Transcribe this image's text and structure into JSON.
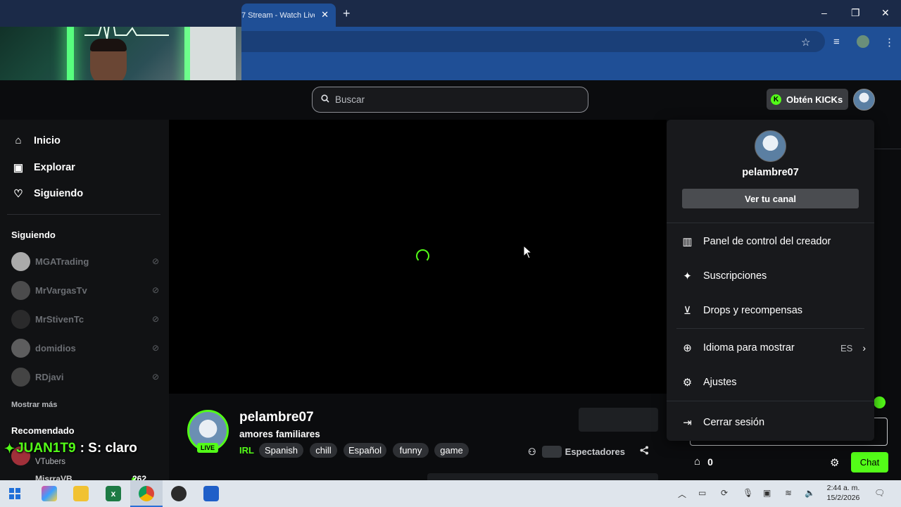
{
  "browser": {
    "tab_title": "7 Stream - Watch Live",
    "tab_close": "✕",
    "new_tab": "+",
    "window_controls": {
      "minimize": "–",
      "restore": "❐",
      "close": "✕"
    }
  },
  "header": {
    "search_placeholder": "Buscar",
    "kicks_button": "Obtén KICKs",
    "kicks_badge": "K"
  },
  "sidebar": {
    "nav": [
      {
        "label": "Inicio",
        "icon": "home-icon"
      },
      {
        "label": "Explorar",
        "icon": "browse-icon"
      },
      {
        "label": "Siguiendo",
        "icon": "heart-icon"
      }
    ],
    "following_title": "Siguiendo",
    "following": [
      {
        "name": "MGATrading"
      },
      {
        "name": "MrVargasTv"
      },
      {
        "name": "MrStivenTc"
      },
      {
        "name": "domidios"
      },
      {
        "name": "RDjavi"
      }
    ],
    "show_more": "Mostrar más",
    "recommended_title": "Recomendado",
    "recommended": [
      {
        "category": "VTubers"
      },
      {
        "name": "MisrraVB",
        "viewers": "262"
      }
    ]
  },
  "chat_overlay": {
    "user": "JUAN1T9",
    "message": ": S: claro"
  },
  "stream": {
    "streamer": "pelambre07",
    "title": "amores familiares",
    "live_badge": "LIVE",
    "category": "IRL",
    "tags": [
      "Spanish",
      "chill",
      "Español",
      "funny",
      "game"
    ],
    "viewers_label": "Espectadores"
  },
  "chat": {
    "gift_count": "0",
    "chat_button": "Chat"
  },
  "menu": {
    "username": "pelambre07",
    "view_channel": "Ver tu canal",
    "items": [
      {
        "label": "Panel de control del creador",
        "icon": "dashboard-icon"
      },
      {
        "label": "Suscripciones",
        "icon": "sparkle-icon"
      },
      {
        "label": "Drops y recompensas",
        "icon": "drops-icon"
      },
      {
        "label": "Idioma para mostrar",
        "icon": "globe-icon",
        "value": "ES"
      },
      {
        "label": "Ajustes",
        "icon": "gear-icon"
      },
      {
        "label": "Cerrar sesión",
        "icon": "logout-icon"
      }
    ]
  },
  "taskbar": {
    "time": "2:44 a. m.",
    "date": "15/2/2026"
  },
  "colors": {
    "accent": "#53fc18",
    "browser_blue": "#1f4f96"
  }
}
